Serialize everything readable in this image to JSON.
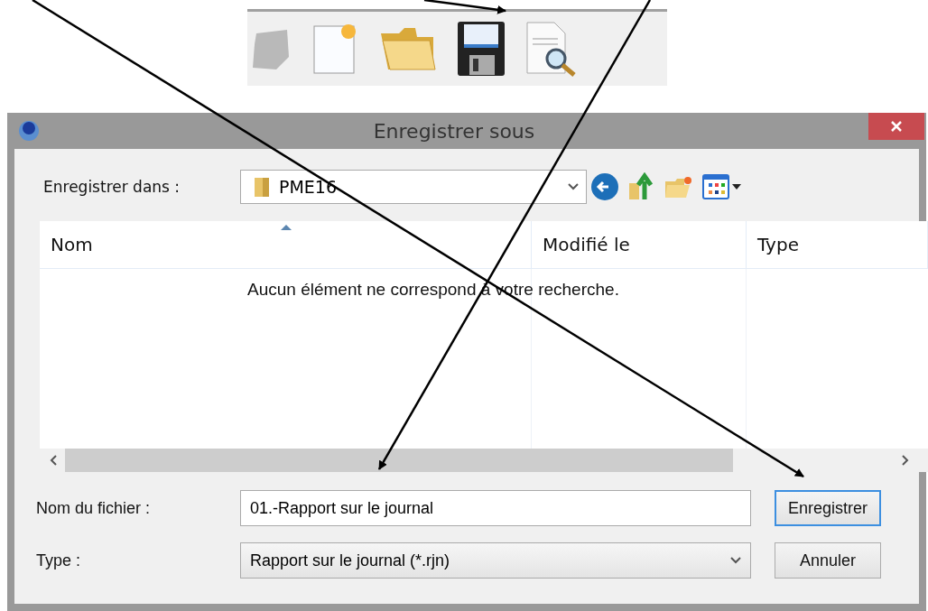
{
  "toolbar": {
    "buttons": [
      {
        "kind": "blank"
      },
      {
        "kind": "new"
      },
      {
        "kind": "open"
      },
      {
        "kind": "save"
      },
      {
        "kind": "preview"
      }
    ]
  },
  "dialog": {
    "title": "Enregistrer sous",
    "location": {
      "label": "Enregistrer dans :",
      "value": "PME16"
    },
    "nav_buttons": [
      {
        "kind": "back"
      },
      {
        "kind": "up"
      },
      {
        "kind": "new-folder"
      },
      {
        "kind": "view"
      }
    ],
    "columns": [
      {
        "label": "Nom",
        "sorted": true
      },
      {
        "label": "Modifié le",
        "sorted": false
      },
      {
        "label": "Type",
        "sorted": false
      }
    ],
    "empty_message": "Aucun élément ne correspond à votre recherche.",
    "file_name": {
      "label": "Nom du fichier :",
      "value": "01.-Rapport sur le journal"
    },
    "file_type": {
      "label": "Type :",
      "value": "Rapport sur le journal (*.rjn)"
    },
    "buttons": [
      {
        "label": "Enregistrer",
        "default": true
      },
      {
        "label": "Annuler",
        "default": false
      }
    ]
  }
}
